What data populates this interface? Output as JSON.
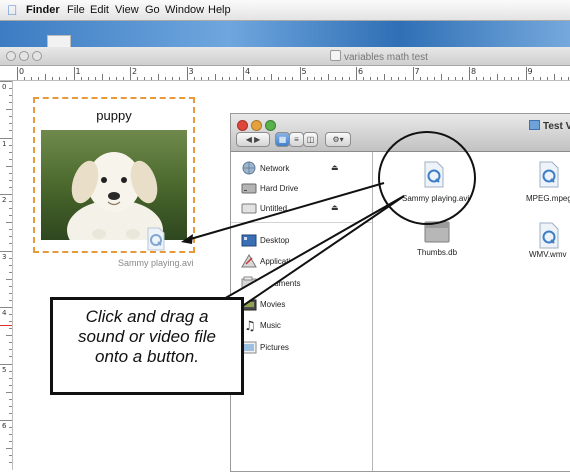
{
  "menubar": {
    "app": "Finder",
    "items": [
      "File",
      "Edit",
      "View",
      "Go",
      "Window",
      "Help"
    ]
  },
  "document": {
    "title": "variables math test",
    "ruler_numbers": [
      "0",
      "1",
      "2",
      "3",
      "4",
      "5",
      "6",
      "7",
      "8",
      "9"
    ],
    "vruler_numbers": [
      "0",
      "1",
      "2",
      "3",
      "4",
      "5",
      "6"
    ]
  },
  "card": {
    "title": "puppy",
    "dropped_file_label": "Sammy playing.avi"
  },
  "finder": {
    "title": "Test Vi",
    "view_buttons": [
      "icon-view",
      "list-view",
      "column-view"
    ],
    "sidebar": {
      "devices": [
        {
          "label": "Network",
          "icon": "network-globe-icon",
          "eject": "⏏"
        },
        {
          "label": "Hard Drive",
          "icon": "hard-drive-icon"
        },
        {
          "label": "Untitled",
          "icon": "disk-icon",
          "eject": "⏏"
        }
      ],
      "places": [
        {
          "label": "Desktop",
          "icon": "desktop-icon"
        },
        {
          "label": "Applications",
          "icon": "applications-icon"
        },
        {
          "label": "Documents",
          "icon": "documents-folder-icon"
        },
        {
          "label": "Movies",
          "icon": "movies-folder-icon"
        },
        {
          "label": "Music",
          "icon": "music-folder-icon"
        },
        {
          "label": "Pictures",
          "icon": "pictures-folder-icon"
        }
      ]
    },
    "files": [
      {
        "label": "Sammy playing.avi",
        "icon": "quicktime-file-icon"
      },
      {
        "label": "MPEG.mpeg",
        "icon": "quicktime-file-icon"
      },
      {
        "label": "Thumbs.db",
        "icon": "generic-file-icon"
      },
      {
        "label": "WMV.wmv",
        "icon": "quicktime-file-icon"
      }
    ]
  },
  "callout": {
    "lines": [
      "Click and drag a",
      "sound or video file",
      "onto a button."
    ]
  },
  "colors": {
    "card_border": "#e69a3a",
    "desktop_blue": "#3c7cc2",
    "selection_blue": "#6fa3d8"
  }
}
